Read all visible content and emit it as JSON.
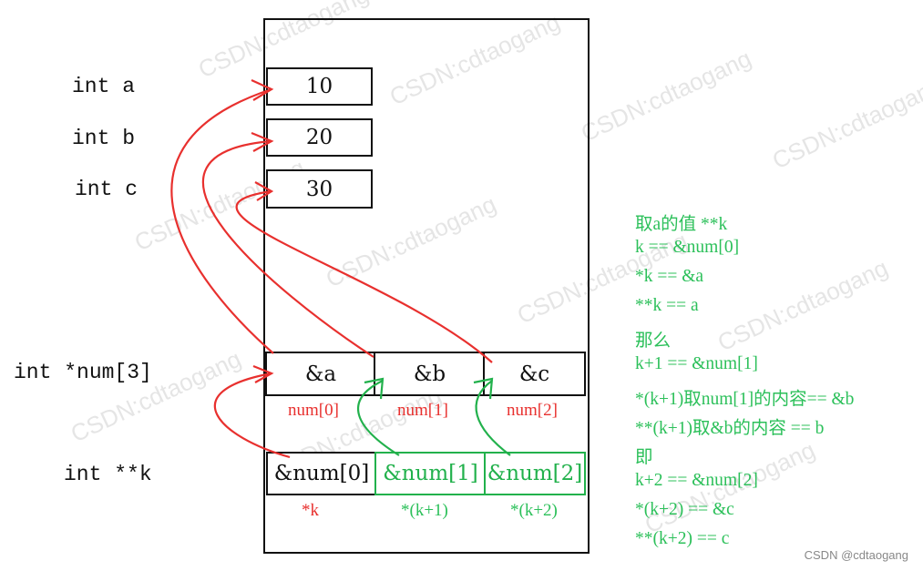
{
  "declarations": {
    "a": "int a",
    "b": "int b",
    "c": "int c",
    "num": "int *num[3]",
    "k": "int **k"
  },
  "values": [
    "10",
    "20",
    "30"
  ],
  "num_cells": [
    "&a",
    "&b",
    "&c"
  ],
  "num_labels": [
    "num[0]",
    "num[1]",
    "num[2]"
  ],
  "k_cells": [
    "&num[0]",
    "&num[1]",
    "&num[2]"
  ],
  "k_labels": [
    "*k",
    "*(k+1)",
    "*(k+2)"
  ],
  "notes": [
    "取a的值 **k",
    "k == &num[0]",
    "*k == &a",
    "**k == a",
    "那么",
    "k+1 == &num[1]",
    "*(k+1)取num[1]的内容== &b",
    "**(k+1)取&b的内容 == b",
    "即",
    "k+2 == &num[2]",
    "*(k+2) == &c",
    "**(k+2) == c"
  ],
  "watermark": "CSDN:cdtaogang",
  "credit": "CSDN @cdtaogang",
  "colors": {
    "red": "#e8302e",
    "green": "#22b14c",
    "black": "#111111"
  }
}
